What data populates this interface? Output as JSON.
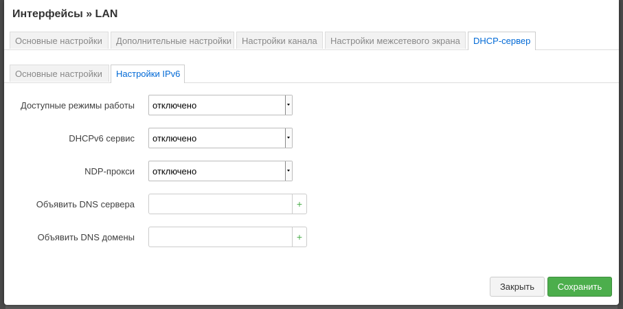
{
  "dialog": {
    "title": "Интерфейсы » LAN"
  },
  "main_tabs": [
    {
      "label": "Основные настройки"
    },
    {
      "label": "Дополнительные настройки"
    },
    {
      "label": "Настройки канала"
    },
    {
      "label": "Настройки межсетевого экрана"
    },
    {
      "label": "DHCP-сервер"
    }
  ],
  "sub_tabs": [
    {
      "label": "Основные настройки"
    },
    {
      "label": "Настройки IPv6"
    }
  ],
  "fields": {
    "ra_mode": {
      "label": "Доступные режимы работы",
      "value": "отключено"
    },
    "dhcpv6": {
      "label": "DHCPv6 сервис",
      "value": "отключено"
    },
    "ndp": {
      "label": "NDP-прокси",
      "value": "отключено"
    },
    "dns_servers": {
      "label": "Объявить DNS сервера",
      "value": "",
      "add": "+"
    },
    "dns_domains": {
      "label": "Объявить DNS домены",
      "value": "",
      "add": "+"
    }
  },
  "footer": {
    "close_label": "Закрыть",
    "save_label": "Сохранить"
  },
  "colors": {
    "accent": "#0069d6",
    "save": "#4cae4c"
  }
}
